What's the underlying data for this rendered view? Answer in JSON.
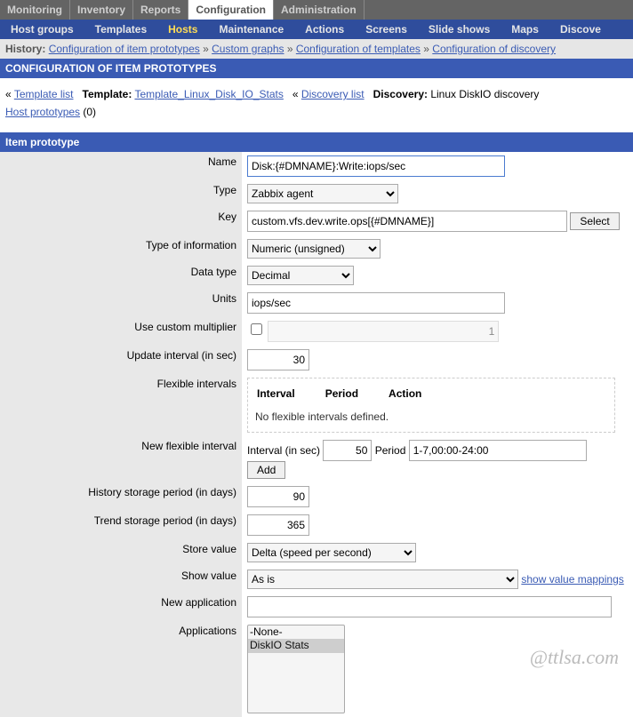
{
  "top_nav": [
    "Monitoring",
    "Inventory",
    "Reports",
    "Configuration",
    "Administration"
  ],
  "top_active": 3,
  "sub_nav": [
    "Host groups",
    "Templates",
    "Hosts",
    "Maintenance",
    "Actions",
    "Screens",
    "Slide shows",
    "Maps",
    "Discove"
  ],
  "sub_active": 2,
  "history_label": "History:",
  "history_items": [
    "Configuration of item prototypes",
    "Custom graphs",
    "Configuration of templates",
    "Configuration of discovery"
  ],
  "page_header": "CONFIGURATION OF ITEM PROTOTYPES",
  "bc": {
    "laquo": "«",
    "template_list": "Template list",
    "template_lbl": "Template:",
    "template_link": "Template_Linux_Disk_IO_Stats",
    "discovery_list": "Discovery list",
    "discovery_lbl": "Discovery:",
    "discovery_txt": "Linux DiskIO discovery",
    "host_proto": "Host prototypes",
    "host_proto_count": "(0)"
  },
  "section_header": "Item prototype",
  "labels": {
    "name": "Name",
    "type": "Type",
    "key": "Key",
    "type_info": "Type of information",
    "data_type": "Data type",
    "units": "Units",
    "ucm": "Use custom multiplier",
    "update": "Update interval (in sec)",
    "flexi": "Flexible intervals",
    "newflex": "New flexible interval",
    "hist": "History storage period (in days)",
    "trend": "Trend storage period (in days)",
    "store": "Store value",
    "show": "Show value",
    "newapp": "New application",
    "apps": "Applications",
    "interval": "Interval",
    "period": "Period",
    "action": "Action",
    "noflex": "No flexible intervals defined.",
    "interval_sec": "Interval (in sec)",
    "period2": "Period",
    "select": "Select",
    "add": "Add",
    "showmap": "show value mappings"
  },
  "values": {
    "name": "Disk:{#DMNAME}:Write:iops/sec",
    "type": "Zabbix agent",
    "key": "custom.vfs.dev.write.ops[{#DMNAME}]",
    "type_info": "Numeric (unsigned)",
    "data_type": "Decimal",
    "units": "iops/sec",
    "multiplier": "1",
    "update": "30",
    "newflex_interval": "50",
    "newflex_period": "1-7,00:00-24:00",
    "hist": "90",
    "trend": "365",
    "store": "Delta (speed per second)",
    "show": "As is",
    "newapp": "",
    "app_options": [
      "-None-",
      "DiskIO Stats"
    ],
    "app_selected": "DiskIO Stats"
  },
  "watermark": "@ttlsa.com"
}
